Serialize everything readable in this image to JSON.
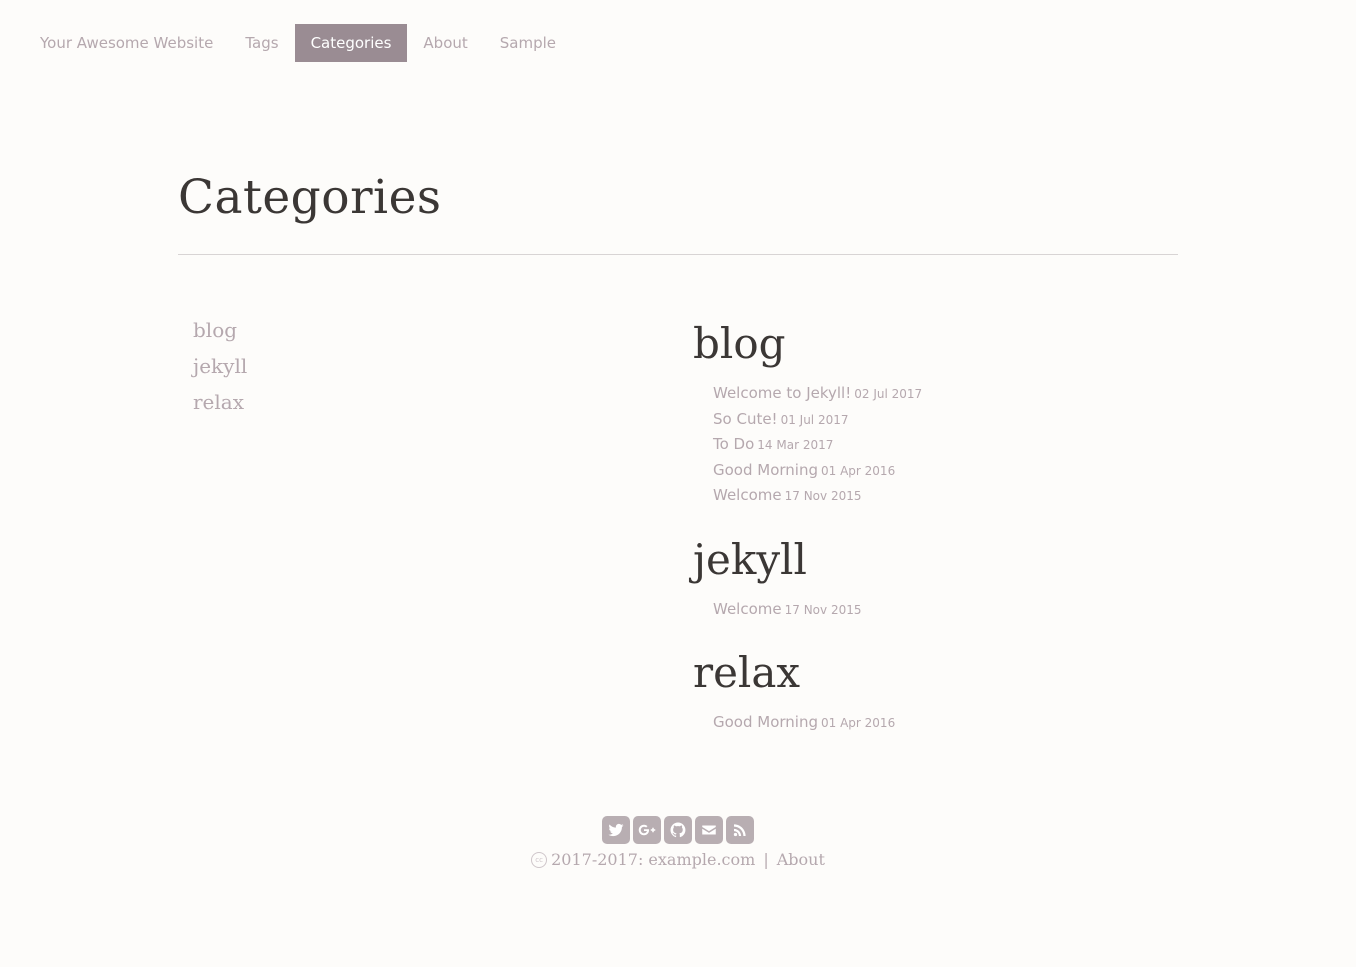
{
  "nav": {
    "brand": "Your Awesome Website",
    "items": [
      {
        "label": "Tags",
        "active": false
      },
      {
        "label": "Categories",
        "active": true
      },
      {
        "label": "About",
        "active": false
      },
      {
        "label": "Sample",
        "active": false
      }
    ]
  },
  "page": {
    "title": "Categories"
  },
  "category_list": [
    "blog",
    "jekyll",
    "relax"
  ],
  "sections": [
    {
      "name": "blog",
      "posts": [
        {
          "title": "Welcome to Jekyll!",
          "date": "02 Jul 2017"
        },
        {
          "title": "So Cute!",
          "date": "01 Jul 2017"
        },
        {
          "title": "To Do",
          "date": "14 Mar 2017"
        },
        {
          "title": "Good Morning",
          "date": "01 Apr 2016"
        },
        {
          "title": "Welcome",
          "date": "17 Nov 2015"
        }
      ]
    },
    {
      "name": "jekyll",
      "posts": [
        {
          "title": "Welcome",
          "date": "17 Nov 2015"
        }
      ]
    },
    {
      "name": "relax",
      "posts": [
        {
          "title": "Good Morning",
          "date": "01 Apr 2016"
        }
      ]
    }
  ],
  "footer": {
    "social_icons": [
      "twitter-icon",
      "google-plus-icon",
      "github-icon",
      "email-icon",
      "rss-icon"
    ],
    "cc_glyph": "cc",
    "copyright": "2017-2017: example.com",
    "separator": "|",
    "about_link": "About"
  },
  "colors": {
    "background": "#fdfcfa",
    "link": "#b5a8ae",
    "active_nav_bg": "#9a8c93",
    "heading": "#3b3735",
    "icon_bg": "#b8aeb2"
  }
}
